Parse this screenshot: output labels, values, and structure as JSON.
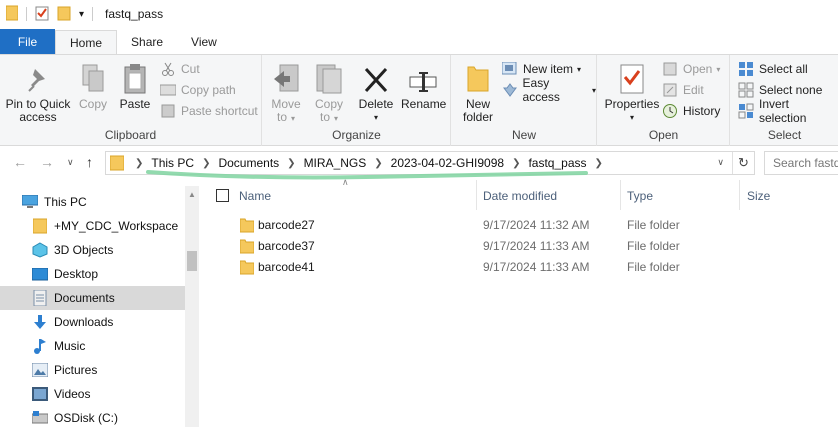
{
  "window": {
    "title": "fastq_pass"
  },
  "ribbon_tabs": [
    "File",
    "Home",
    "Share",
    "View"
  ],
  "ribbon": {
    "clipboard": {
      "label": "Clipboard",
      "pin_label_1": "Pin to Quick",
      "pin_label_2": "access",
      "copy": "Copy",
      "paste": "Paste",
      "cut": "Cut",
      "copy_path": "Copy path",
      "paste_shortcut": "Paste shortcut"
    },
    "organize": {
      "label": "Organize",
      "move_to_1": "Move",
      "move_to_2": "to",
      "copy_to_1": "Copy",
      "copy_to_2": "to",
      "delete": "Delete",
      "rename": "Rename"
    },
    "new": {
      "label": "New",
      "new_folder_1": "New",
      "new_folder_2": "folder",
      "new_item": "New item",
      "easy_access": "Easy access"
    },
    "open": {
      "label": "Open",
      "properties": "Properties",
      "open": "Open",
      "edit": "Edit",
      "history": "History"
    },
    "select": {
      "label": "Select",
      "select_all": "Select all",
      "select_none": "Select none",
      "invert_selection": "Invert selection"
    }
  },
  "address": {
    "crumbs": [
      "This PC",
      "Documents",
      "MIRA_NGS",
      "2023-04-02-GHI9098",
      "fastq_pass"
    ],
    "search_placeholder": "Search fastq"
  },
  "nav_pane": {
    "items": [
      {
        "label": "This PC",
        "icon": "pc-icon"
      },
      {
        "label": "+MY_CDC_Workspace",
        "icon": "folder-icon"
      },
      {
        "label": "3D Objects",
        "icon": "3d-objects-icon"
      },
      {
        "label": "Desktop",
        "icon": "desktop-icon"
      },
      {
        "label": "Documents",
        "icon": "documents-icon"
      },
      {
        "label": "Downloads",
        "icon": "downloads-icon"
      },
      {
        "label": "Music",
        "icon": "music-icon"
      },
      {
        "label": "Pictures",
        "icon": "pictures-icon"
      },
      {
        "label": "Videos",
        "icon": "videos-icon"
      },
      {
        "label": "OSDisk (C:)",
        "icon": "disk-icon"
      }
    ]
  },
  "file_list": {
    "columns": [
      "Name",
      "Date modified",
      "Type",
      "Size"
    ],
    "rows": [
      {
        "name": "barcode27",
        "date": "9/17/2024 11:32 AM",
        "type": "File folder",
        "size": ""
      },
      {
        "name": "barcode37",
        "date": "9/17/2024 11:33 AM",
        "type": "File folder",
        "size": ""
      },
      {
        "name": "barcode41",
        "date": "9/17/2024 11:33 AM",
        "type": "File folder",
        "size": ""
      }
    ]
  },
  "colors": {
    "file_tab": "#1f6fc5",
    "folder": "#f5c85c",
    "highlight": "#7fd4a0",
    "selected": "#d9d9d9"
  }
}
